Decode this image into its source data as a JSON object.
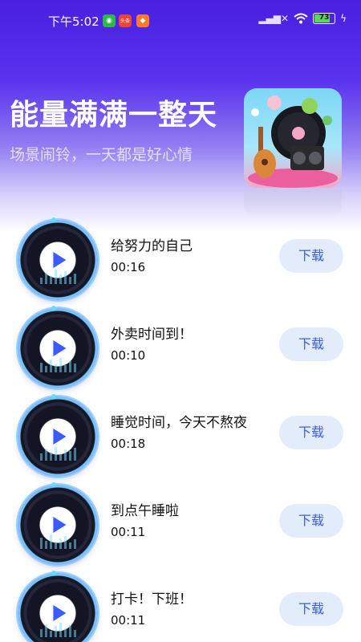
{
  "status_bar": {
    "time": "下午5:02",
    "battery": "73",
    "app_badge_2": "头条"
  },
  "hero": {
    "title": "能量满满一整天",
    "subtitle": "场景闹铃，一天都是好心情"
  },
  "songs": [
    {
      "title": "给努力的自己",
      "duration": "00:16",
      "action": "下载"
    },
    {
      "title": "外卖时间到！",
      "duration": "00:10",
      "action": "下载"
    },
    {
      "title": "睡觉时间，今天不熬夜",
      "duration": "00:18",
      "action": "下载"
    },
    {
      "title": "到点午睡啦",
      "duration": "00:11",
      "action": "下载"
    },
    {
      "title": "打卡！下班！",
      "duration": "00:11",
      "action": "下载"
    }
  ],
  "colors": {
    "hero_top": "#4a1fe0",
    "download_bg": "#e2ecfb",
    "download_text": "#3a5fd8",
    "play": "#3b5bff"
  },
  "icons": [
    "play-icon",
    "wifi-icon",
    "signal-icon",
    "battery-icon",
    "charging-icon"
  ]
}
